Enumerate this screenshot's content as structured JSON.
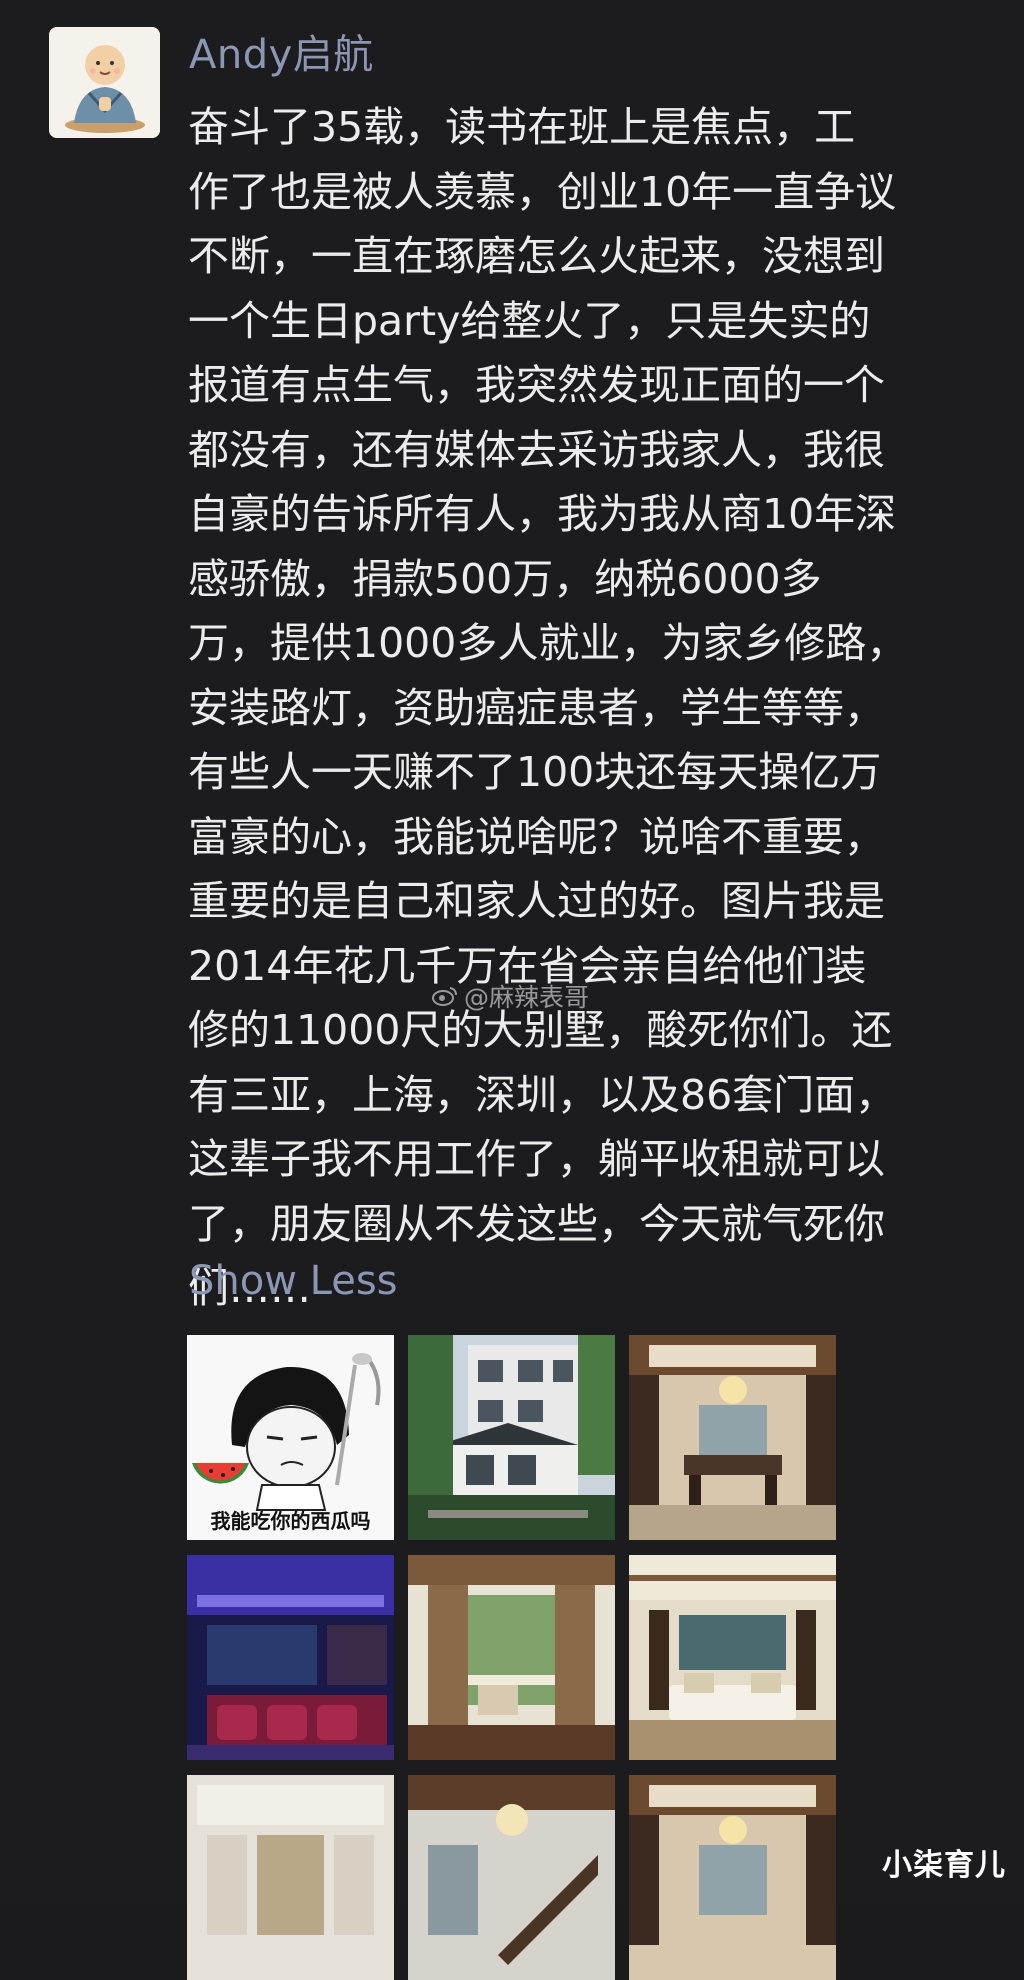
{
  "post": {
    "author": "Andy启航",
    "lines": [
      "奋斗了35载，读书在班上是焦点，工",
      "作了也是被人羡慕，创业10年一直争议",
      "不断，一直在琢磨怎么火起来，没想到",
      "一个生日party给整火了，只是失实的",
      "报道有点生气，我突然发现正面的一个",
      "都没有，还有媒体去采访我家人，我很",
      "自豪的告诉所有人，我为我从商10年深",
      "感骄傲，捐款500万，纳税6000多",
      "万，提供1000多人就业，为家乡修路，",
      "安装路灯，资助癌症患者，学生等等，",
      "有些人一天赚不了100块还每天操亿万",
      "富豪的心，我能说啥呢？说啥不重要，",
      "重要的是自己和家人过的好。图片我是",
      "2014年花几千万在省会亲自给他们装",
      "修的11000尺的大别墅，酸死你们。还",
      "有三亚，上海，深圳，以及86套门面，",
      "这辈子我不用工作了，躺平收租就可以",
      "了，朋友圈从不发这些，今天就气死你",
      "们……"
    ],
    "toggle_label": "Show Less"
  },
  "photos": [
    {
      "name": "meme",
      "caption": "我能吃你的西瓜吗"
    },
    {
      "name": "villa-exterior"
    },
    {
      "name": "dining-room"
    },
    {
      "name": "home-theater"
    },
    {
      "name": "living-room-curtains"
    },
    {
      "name": "lounge"
    },
    {
      "name": "hallway"
    },
    {
      "name": "staircase"
    },
    {
      "name": "dining-room-2"
    }
  ],
  "watermarks": {
    "center": "@麻辣表哥",
    "corner": "小柒育儿"
  },
  "colors": {
    "background": "#1c1c1e",
    "text": "#ececec",
    "accent": "#8c97b4"
  }
}
